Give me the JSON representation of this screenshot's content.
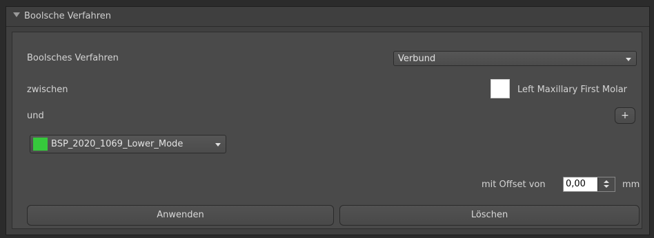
{
  "panel": {
    "title": "Boolsche Verfahren"
  },
  "form": {
    "operation_label": "Boolsches Verfahren",
    "operation_value": "Verbund",
    "between_label": "zwischen",
    "object_a": "Left Maxillary First Molar",
    "object_a_color": "#ffffff",
    "and_label": "und",
    "add_label": "+",
    "object_b": "BSP_2020_1069_Lower_Mode",
    "object_b_color": "#36c93c",
    "offset_label": "mit Offset von",
    "offset_value": "0,00",
    "offset_unit": "mm"
  },
  "actions": {
    "apply_label": "Anwenden",
    "delete_label": "Löschen"
  }
}
